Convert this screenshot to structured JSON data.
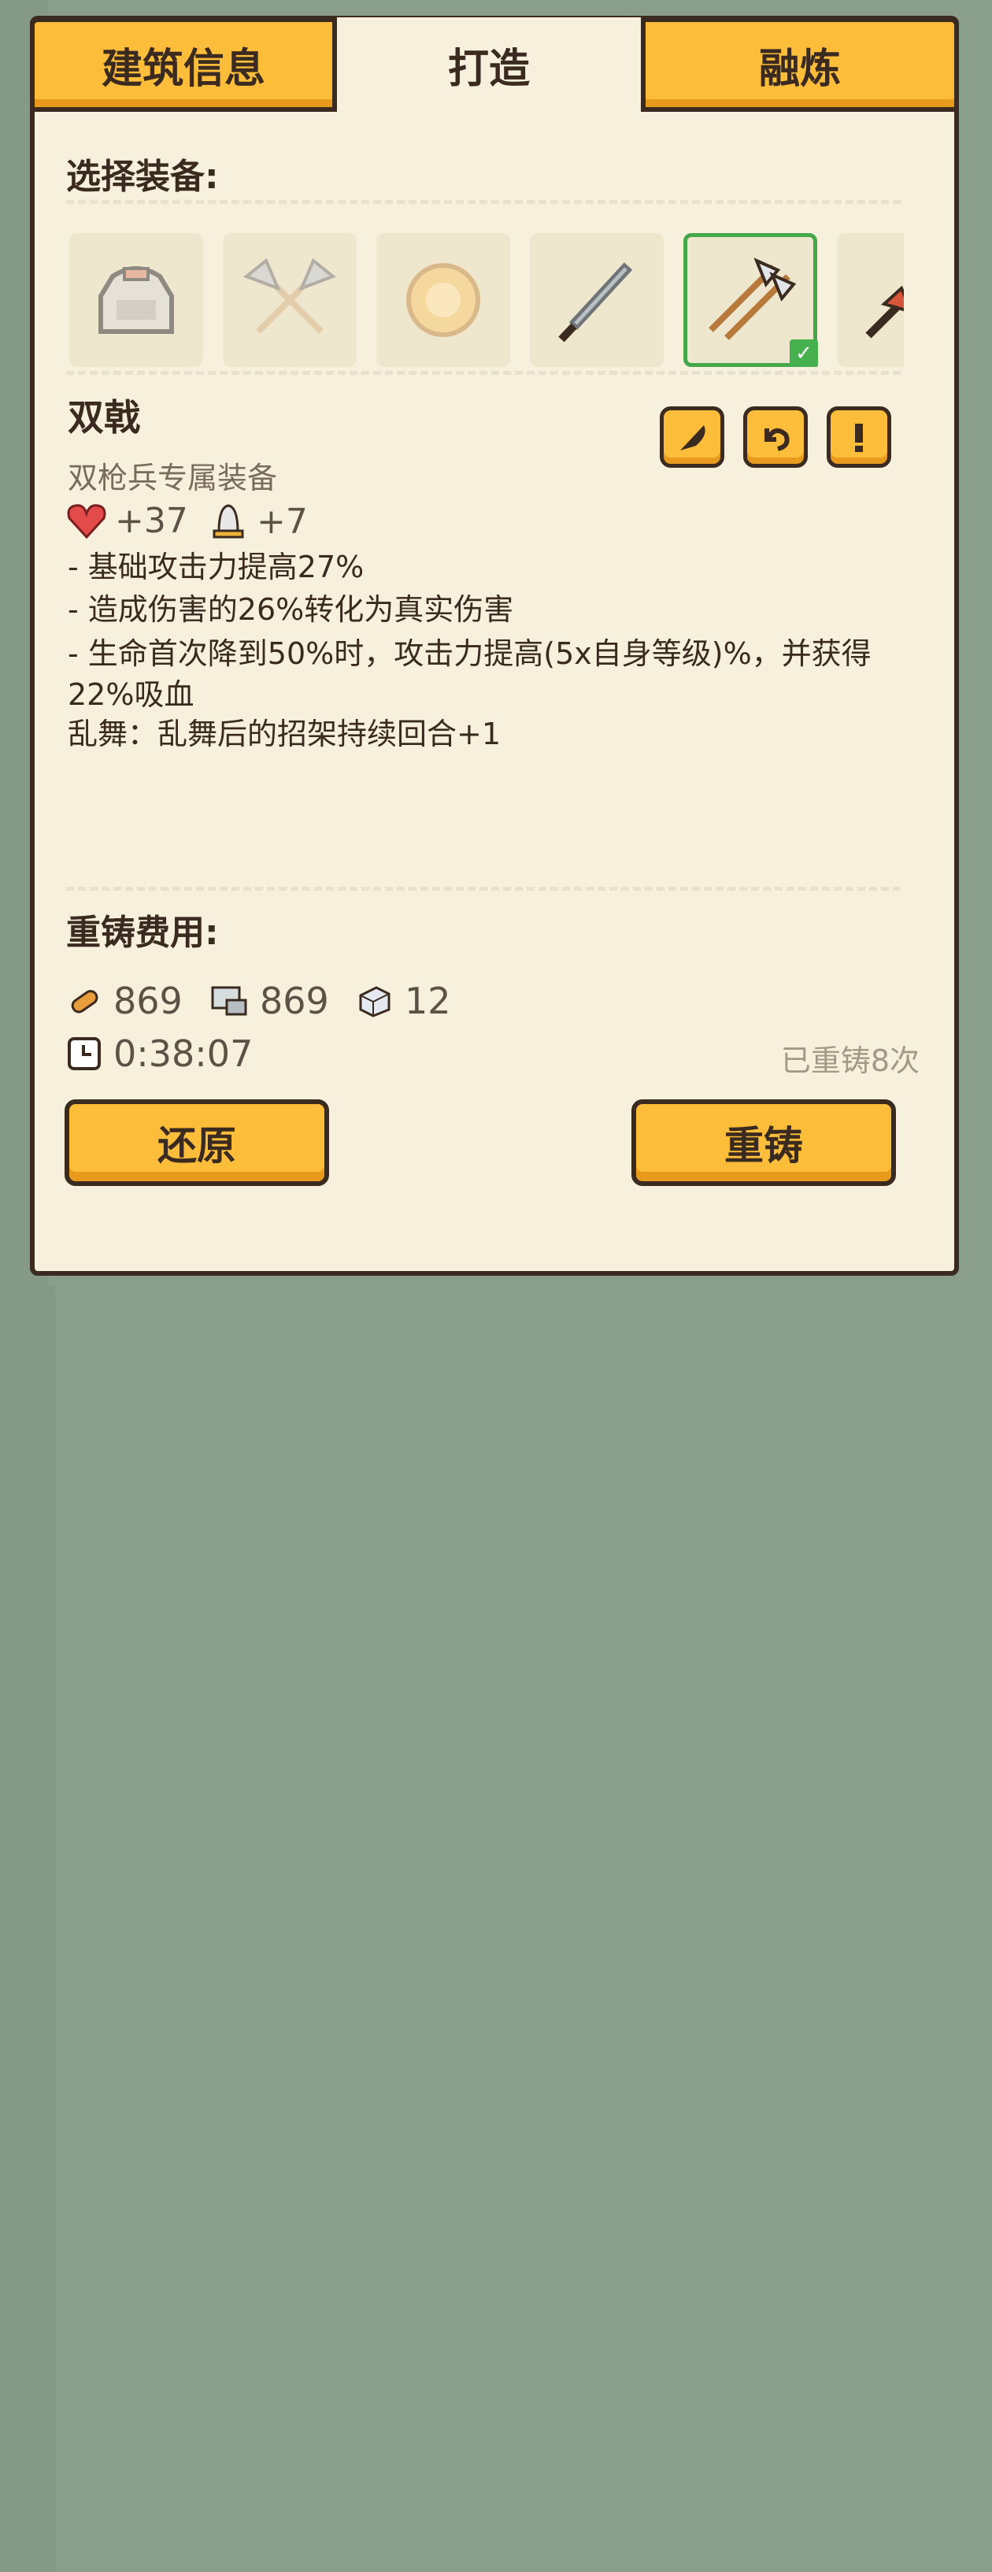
{
  "tabs": [
    {
      "label": "建筑信息",
      "active": false
    },
    {
      "label": "打造",
      "active": true
    },
    {
      "label": "融炼",
      "active": false
    }
  ],
  "select_title": "选择装备:",
  "equipment_slots": [
    {
      "icon": "chest-armor-icon",
      "selected": false
    },
    {
      "icon": "crossed-axes-icon",
      "selected": false
    },
    {
      "icon": "round-shield-icon",
      "selected": false
    },
    {
      "icon": "sword-icon",
      "selected": false
    },
    {
      "icon": "twin-halberds-icon",
      "selected": true
    },
    {
      "icon": "spear-icon",
      "selected": false
    }
  ],
  "item": {
    "name": "双戟",
    "subtitle": "双枪兵专属装备",
    "stats": [
      {
        "icon": "heart-icon",
        "value": "+37"
      },
      {
        "icon": "bell-defense-icon",
        "value": "+7"
      }
    ],
    "effects": [
      "- 基础攻击力提高27%",
      "- 造成伤害的26%转化为真实伤害",
      "- 生命首次降到50%时，攻击力提高(5x自身等级)%，并获得22%吸血",
      "乱舞：乱舞后的招架持续回合+1"
    ]
  },
  "action_icons": [
    "feather-icon",
    "undo-icon",
    "exclamation-icon"
  ],
  "cost": {
    "title": "重铸费用:",
    "items": [
      {
        "icon": "bread-icon",
        "value": "869"
      },
      {
        "icon": "stone-icon",
        "value": "869"
      },
      {
        "icon": "iron-icon",
        "value": "12"
      }
    ],
    "time": "0:38:07",
    "reforged": "已重铸8次"
  },
  "buttons": {
    "restore": "还原",
    "reforge": "重铸"
  },
  "colors": {
    "accent": "#fcbe3a",
    "selected": "#44a84a",
    "panel": "#f7f0dd",
    "outline": "#3a2a1f"
  }
}
